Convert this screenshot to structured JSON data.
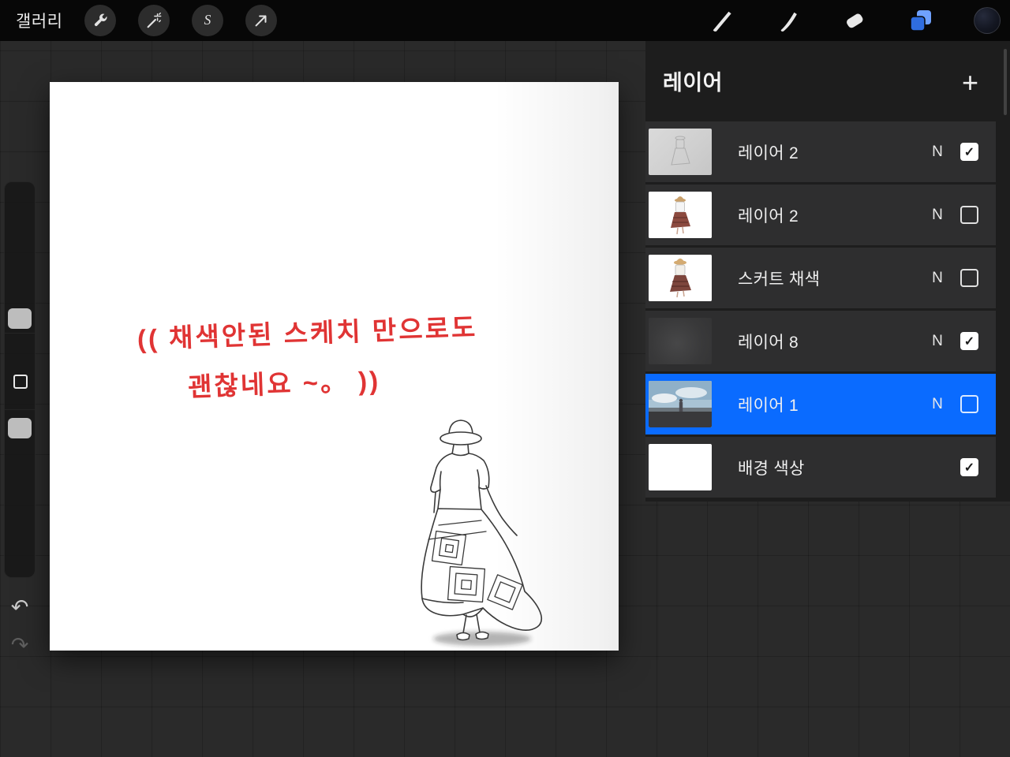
{
  "topbar": {
    "gallery_label": "갤러리",
    "left_tools": [
      {
        "label": "actions",
        "icon": "wrench-icon"
      },
      {
        "label": "adjustments",
        "icon": "magic-wand-icon"
      },
      {
        "label": "selection",
        "icon": "selection-s-icon"
      },
      {
        "label": "transform",
        "icon": "arrow-cursor-icon"
      }
    ],
    "right_tools": [
      {
        "label": "paint",
        "icon": "brush-icon"
      },
      {
        "label": "smudge",
        "icon": "smudge-icon"
      },
      {
        "label": "erase",
        "icon": "eraser-icon"
      },
      {
        "label": "layers",
        "icon": "layers-icon",
        "active": true
      },
      {
        "label": "color",
        "icon": "color-swatch-icon"
      }
    ],
    "accent_color": "#3c82f6"
  },
  "side_toolbar": {
    "undo_icon": "↶",
    "redo_icon": "↷"
  },
  "canvas": {
    "annotation": {
      "line1": "((  채색안된  스케치  만으로도",
      "line2": "괜찮네요 ~。  ))",
      "color": "#e03434"
    }
  },
  "layers_panel": {
    "title": "레이어",
    "add_button_label": "+",
    "selected_color": "#0a6bff",
    "rows": [
      {
        "name": "레이어 2",
        "blend_mode": "N",
        "visible": true,
        "selected": false,
        "thumbnail": "gray-sketch"
      },
      {
        "name": "레이어 2",
        "blend_mode": "N",
        "visible": false,
        "selected": false,
        "thumbnail": "colored-figure"
      },
      {
        "name": "스커트 채색",
        "blend_mode": "N",
        "visible": false,
        "selected": false,
        "thumbnail": "colored-figure-hat"
      },
      {
        "name": "레이어 8",
        "blend_mode": "N",
        "visible": true,
        "selected": false,
        "thumbnail": "dark"
      },
      {
        "name": "레이어 1",
        "blend_mode": "N",
        "visible": false,
        "selected": true,
        "thumbnail": "beach-photo"
      },
      {
        "name": "배경 색상",
        "blend_mode": "",
        "visible": true,
        "selected": false,
        "thumbnail": "white"
      }
    ]
  }
}
